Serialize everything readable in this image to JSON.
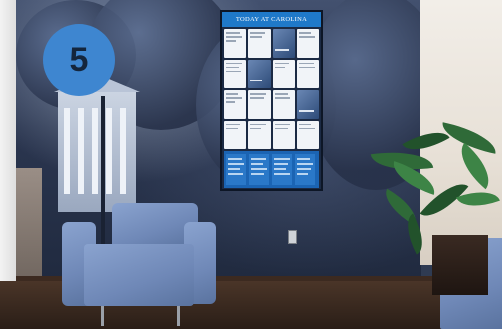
{
  "badge": {
    "number": "5"
  },
  "screen": {
    "header_title": "TODAY AT CAROLINA"
  },
  "colors": {
    "badge_blue": "#3e86d0",
    "screen_header_blue": "#1f79c9",
    "chair_blue": "#7f98c6"
  }
}
